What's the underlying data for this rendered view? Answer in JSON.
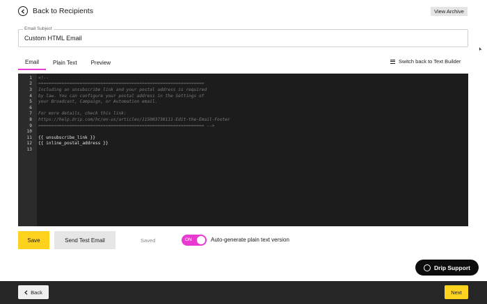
{
  "header": {
    "back_label": "Back to Recipients",
    "back_icon": "circle-chevron-left-icon",
    "view_archive_label": "View Archive"
  },
  "subject": {
    "label": "Email Subject",
    "value": "Custom HTML Email"
  },
  "tabs": [
    {
      "label": "Email",
      "active": true
    },
    {
      "label": "Plain Text",
      "active": false
    },
    {
      "label": "Preview",
      "active": false
    }
  ],
  "switch_builder": {
    "label": "Switch back to Text Builder",
    "icon": "menu-icon"
  },
  "editor": {
    "lines": [
      {
        "n": "1",
        "text": "<!--",
        "kind": "comment"
      },
      {
        "n": "2",
        "text": "================================================================",
        "kind": "comment"
      },
      {
        "n": "3",
        "text": "Including an unsubscribe link and your postal address is required",
        "kind": "comment"
      },
      {
        "n": "4",
        "text": "by law. You can configure your postal address in the Settings of",
        "kind": "comment"
      },
      {
        "n": "5",
        "text": "your Broadcast, Campaign, or Automation email.",
        "kind": "comment"
      },
      {
        "n": "6",
        "text": "",
        "kind": "comment"
      },
      {
        "n": "7",
        "text": "For more details, check this link:",
        "kind": "comment"
      },
      {
        "n": "8",
        "text": "https://help.drip.com/hc/en-us/articles/115003730111-Edit-the-Email-Footer",
        "kind": "comment"
      },
      {
        "n": "9",
        "text": "================================================================ -->",
        "kind": "comment"
      },
      {
        "n": "10",
        "text": "",
        "kind": "template"
      },
      {
        "n": "11",
        "text": "{{ unsubscribe_link }}",
        "kind": "template"
      },
      {
        "n": "12",
        "text": "{{ inline_postal_address }}",
        "kind": "template"
      },
      {
        "n": "13",
        "text": "",
        "kind": "template"
      }
    ]
  },
  "actions": {
    "save_label": "Save",
    "send_test_label": "Send Test Email",
    "saved_status": "Saved",
    "toggle_state": "ON",
    "autogen_label": "Auto-generate plain text version"
  },
  "support": {
    "label": "Drip Support",
    "icon": "chat-bubble-icon"
  },
  "footer": {
    "back_label": "Back",
    "next_label": "Next"
  },
  "colors": {
    "accent_pink": "#e83ad1",
    "accent_yellow": "#ffd31d",
    "editor_bg": "#1c1c1c",
    "footer_bg": "#262626"
  }
}
